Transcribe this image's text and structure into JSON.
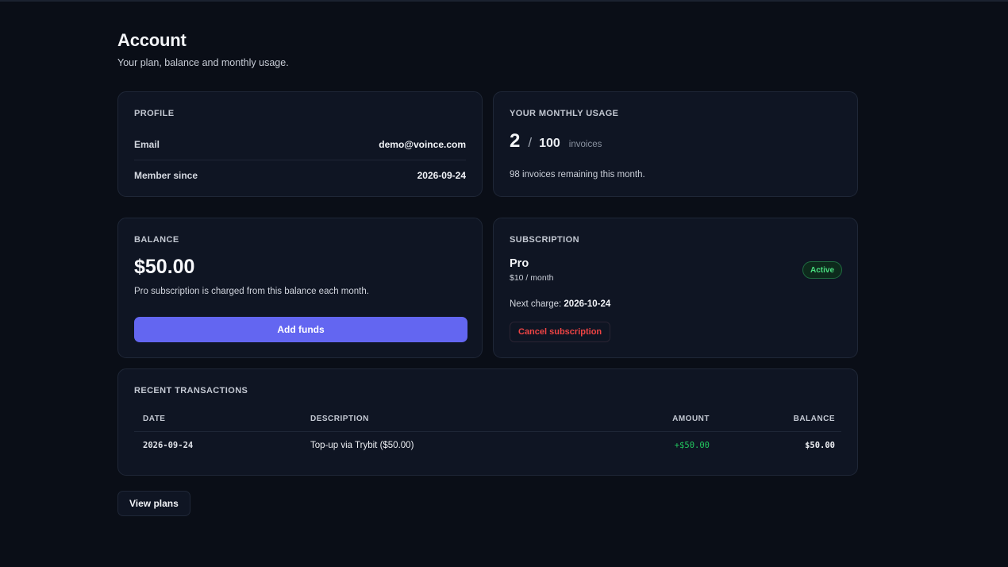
{
  "header": {
    "title": "Account",
    "subtitle": "Your plan, balance and monthly usage."
  },
  "profile": {
    "title": "PROFILE",
    "email_label": "Email",
    "email_value": "demo@voince.com",
    "member_label": "Member since",
    "member_value": "2026-09-24"
  },
  "usage": {
    "title": "YOUR MONTHLY USAGE",
    "used": "2",
    "separator": "/",
    "limit": "100",
    "unit": "invoices",
    "used_fraction": 0.02,
    "remaining_text": "98 invoices remaining this month."
  },
  "balance": {
    "title": "BALANCE",
    "amount": "$50.00",
    "note": "Pro subscription is charged from this balance each month.",
    "add_funds_label": "Add funds"
  },
  "subscription": {
    "title": "SUBSCRIPTION",
    "plan_name": "Pro",
    "plan_price": "$10 / month",
    "status": "Active",
    "next_charge_label": "Next charge:",
    "next_charge_date": "2026-10-24",
    "cancel_label": "Cancel subscription"
  },
  "transactions": {
    "title": "RECENT TRANSACTIONS",
    "columns": {
      "date": "DATE",
      "description": "DESCRIPTION",
      "amount": "AMOUNT",
      "balance": "BALANCE"
    },
    "rows": [
      {
        "date": "2026-09-24",
        "description": "Top-up via Trybit ($50.00)",
        "amount": "+$50.00",
        "balance": "$50.00"
      }
    ]
  },
  "footer": {
    "view_plans_label": "View plans"
  },
  "colors": {
    "background": "#0a0e17",
    "card": "#0f1523",
    "accent": "#6366f1",
    "success": "#22c55e",
    "danger": "#ef4444"
  }
}
